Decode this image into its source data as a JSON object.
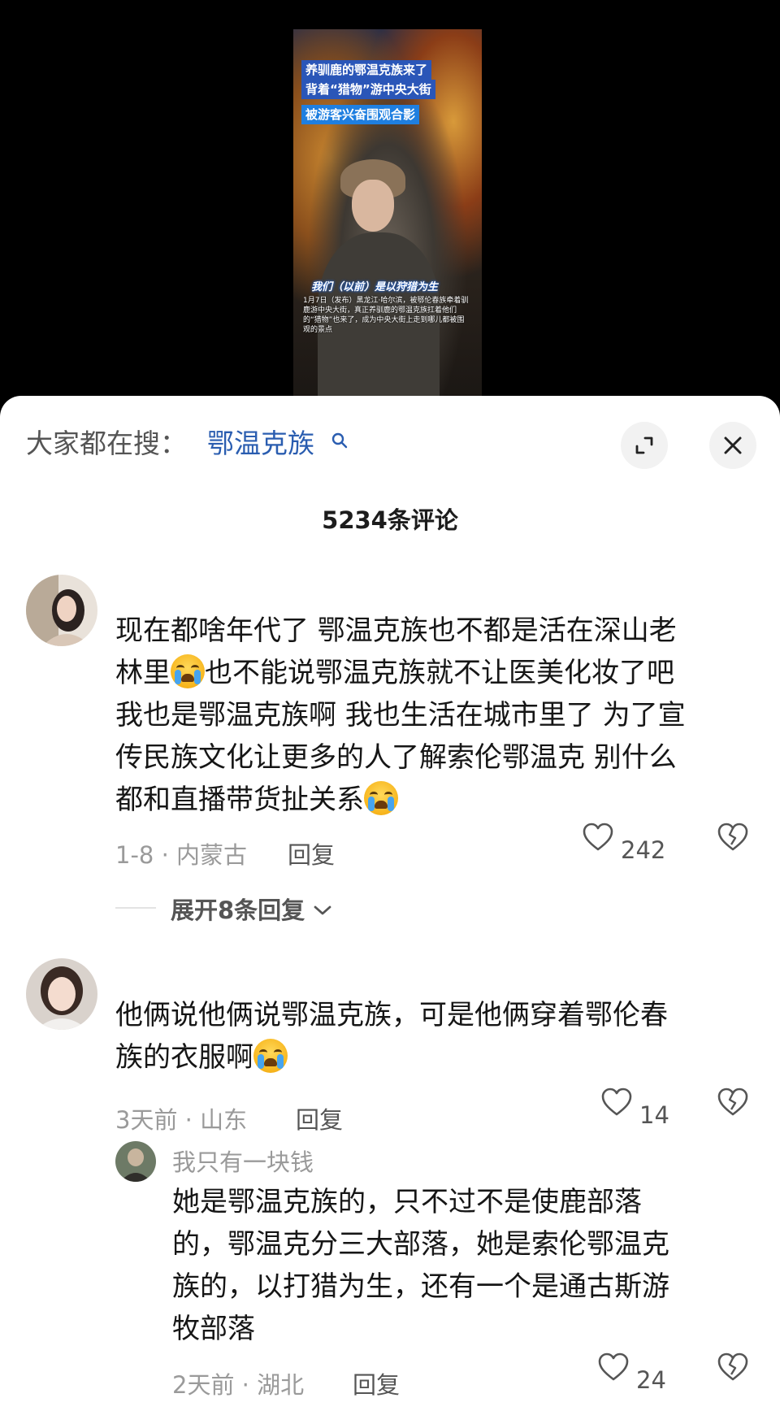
{
  "video": {
    "overlay_lines": [
      "养驯鹿的鄂温克族来了",
      "背着“猎物”游中央大街",
      "被游客兴奋围观合影"
    ],
    "caption_title": "我们（以前）是以狩猎为生",
    "caption_body": "1月7日（发布）黑龙江·哈尔滨，被鄂伦春族牵着驯鹿游中央大街，真正养驯鹿的鄂温克族扛着他们的“猎物”也来了，成为中央大街上走到哪儿都被围观的景点"
  },
  "header": {
    "trending_label": "大家都在搜：",
    "trending_term": "鄂温克族",
    "comment_count": "5234条评论"
  },
  "comments": [
    {
      "text_1": "现在都啥年代了 鄂温克族也不都是活在深山老",
      "text_2a": "林里",
      "text_2b": "也不能说鄂温克族就不让医美化妆了吧",
      "text_3": "我也是鄂温克族啊 我也生活在城市里了 为了宣",
      "text_4": "传民族文化让更多的人了解索伦鄂温克 别什么",
      "text_5": "都和直播带货扯关系",
      "meta": "1-8 · 内蒙古",
      "reply": "回复",
      "likes": "242",
      "expand_replies": "展开8条回复"
    },
    {
      "text_1": "他俩说他俩说鄂温克族，可是他俩穿着鄂伦春",
      "text_2": "族的衣服啊",
      "meta": "3天前 · 山东",
      "reply": "回复",
      "likes": "14",
      "sub_reply": {
        "username": "我只有一块钱",
        "text_1": "她是鄂温克族的，只不过不是使鹿部落",
        "text_2": "的，鄂温克分三大部落，她是索伦鄂温克",
        "text_3": "族的，以打猎为生，还有一个是通古斯游",
        "text_4": "牧部落",
        "meta": "2天前 · 湖北",
        "reply": "回复",
        "likes": "24"
      }
    }
  ],
  "colors": {
    "link_blue": "#2a5db0",
    "meta_gray": "#9a9a9a",
    "text_dark": "#161616"
  }
}
